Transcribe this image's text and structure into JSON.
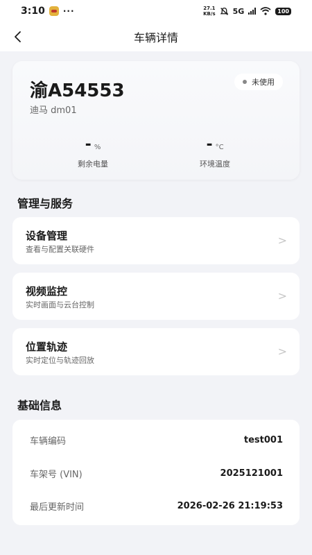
{
  "status_bar": {
    "time": "3:10",
    "more": "···",
    "net_speed_value": "27.1",
    "net_speed_unit": "KB/s",
    "network_type": "5G",
    "battery": "100"
  },
  "header": {
    "title": "车辆详情"
  },
  "vehicle": {
    "plate": "渝A54553",
    "model": "迪马 dm01",
    "status": "未使用",
    "battery_value": "-",
    "battery_unit": "%",
    "battery_label": "剩余电量",
    "temp_value": "-",
    "temp_unit": "°C",
    "temp_label": "环境温度"
  },
  "services": {
    "section_title": "管理与服务",
    "items": [
      {
        "title": "设备管理",
        "desc": "查看与配置关联硬件",
        "chevron": ">"
      },
      {
        "title": "视频监控",
        "desc": "实时画面与云台控制",
        "chevron": ">"
      },
      {
        "title": "位置轨迹",
        "desc": "实时定位与轨迹回放",
        "chevron": ">"
      }
    ]
  },
  "info": {
    "section_title": "基础信息",
    "rows": [
      {
        "label": "车辆编码",
        "value": "test001"
      },
      {
        "label": "车架号 (VIN)",
        "value": "2025121001"
      },
      {
        "label": "最后更新时间",
        "value": "2026-02-26 21:19:53"
      }
    ]
  },
  "colors": {
    "background": "#f2f3f7",
    "card": "#ffffff",
    "status_dot": "#888888",
    "chevron": "#c6c6c6"
  },
  "icons": {
    "back": "chevron-left-icon",
    "mute": "bell-mute-icon",
    "wifi": "wifi-icon",
    "signal": "signal-icon"
  }
}
